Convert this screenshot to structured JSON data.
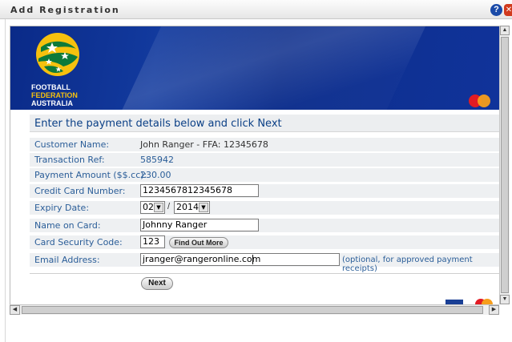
{
  "window": {
    "title": "Add Registration",
    "help_glyph": "?",
    "close_glyph": "✕",
    "help_icon": "help-icon",
    "close_icon": "close-icon"
  },
  "banner": {
    "logo_line1": "FOOTBALL",
    "logo_line2": "FEDERATION",
    "logo_line3": "AUSTRALIA",
    "colors": {
      "banner_blue": "#0d2e8c",
      "logo_gold": "#f6c10e"
    }
  },
  "form": {
    "heading": "Enter the payment details below and click Next",
    "customer_name_label": "Customer Name:",
    "customer_name_value": "John Ranger - FFA: 12345678",
    "transaction_ref_label": "Transaction Ref:",
    "transaction_ref_value": "585942",
    "payment_amount_label": "Payment Amount ($$.cc):",
    "payment_amount_value": "230.00",
    "card_number_label": "Credit Card Number:",
    "card_number_value": "1234567812345678",
    "expiry_label": "Expiry Date:",
    "expiry_month": "02",
    "expiry_separator": "/",
    "expiry_year": "2014",
    "name_on_card_label": "Name on Card:",
    "name_on_card_value": "Johnny Ranger",
    "security_code_label": "Card Security Code:",
    "security_code_value": "123",
    "find_out_more_label": "Find Out More",
    "email_label": "Email Address:",
    "email_value": "jranger@rangeronline.com",
    "email_hint": "(optional, for approved payment receipts)",
    "next_label": "Next",
    "colors": {
      "label_blue": "#2a5d98",
      "heading_blue": "#0a3f86",
      "row_bg": "#eef0f2"
    }
  },
  "scrollbars": {
    "up_glyph": "▲",
    "down_glyph": "▼",
    "left_glyph": "◀",
    "right_glyph": "▶",
    "dropdown_glyph": "▼"
  }
}
